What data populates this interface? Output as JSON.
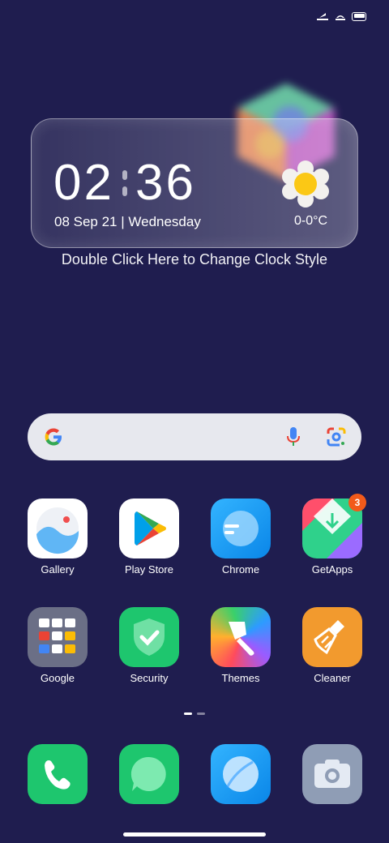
{
  "status_bar": {
    "icons": [
      "network-icon",
      "wifi-icon",
      "battery-icon"
    ]
  },
  "clock_widget": {
    "hours": "02",
    "minutes": "36",
    "date": "08 Sep 21 | Wednesday",
    "temperature": "0-0°C",
    "weather_icon": "sunny-icon",
    "hint": "Double Click Here to Change Clock Style"
  },
  "search_bar": {
    "logo": "google-g-icon",
    "voice": "mic-icon",
    "lens": "lens-icon"
  },
  "apps_row1": [
    {
      "label": "Gallery"
    },
    {
      "label": "Play Store"
    },
    {
      "label": "Chrome"
    },
    {
      "label": "GetApps",
      "badge": "3"
    }
  ],
  "apps_row2": [
    {
      "label": "Google"
    },
    {
      "label": "Security"
    },
    {
      "label": "Themes"
    },
    {
      "label": "Cleaner"
    }
  ],
  "page_indicator": {
    "pages": 2,
    "current": 1
  },
  "dock": [
    {
      "icon": "phone-icon"
    },
    {
      "icon": "messages-icon"
    },
    {
      "icon": "browser-icon"
    },
    {
      "icon": "camera-icon"
    }
  ],
  "colors": {
    "background": "#1f1d4f",
    "badge": "#f25a1a",
    "search_bg": "#e7e8ee"
  }
}
